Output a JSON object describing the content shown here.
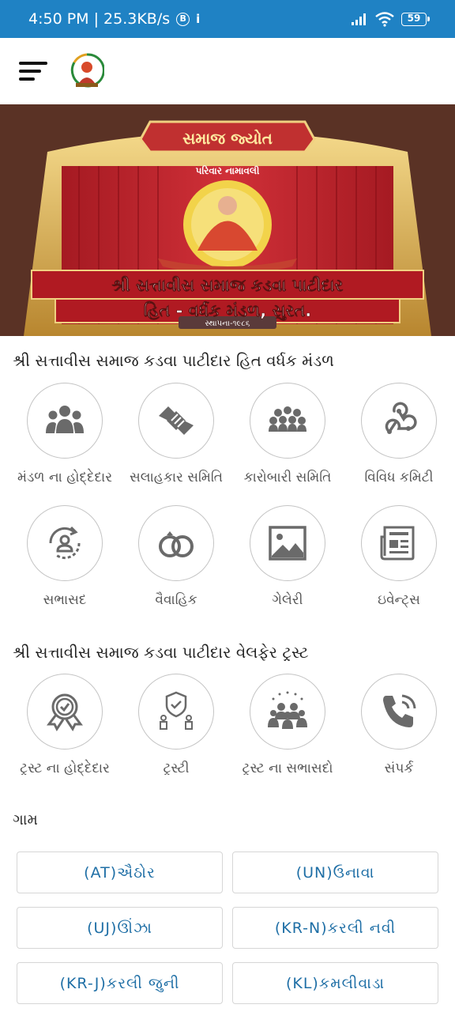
{
  "status_bar": {
    "time_speed": "4:50 PM | 25.3KB/s",
    "b_badge": "B",
    "info_icon": "i",
    "battery": "59"
  },
  "banner": {
    "top_title": "સમાજ જ્યોત",
    "subtitle": "પરિવાર નામાવલી",
    "line1": "શ્રી સત્તાવીસ સમાજ કડવા પાટીદાર",
    "line2": "હિત - વર્ધક મંડળ, સુરત.",
    "founded": "સ્થાપના-૧૯૮૬"
  },
  "mandal": {
    "title": "શ્રી સત્તાવીસ સમાજ કડવા પાટીદાર હિત વર્ધક મંડળ",
    "items": [
      {
        "label": "મંડળ ના હોદ્દેદાર",
        "icon": "users-group-icon"
      },
      {
        "label": "સલાહકાર સમિતિ",
        "icon": "handshake-icon"
      },
      {
        "label": "કારોબારી સમિતિ",
        "icon": "crowd-icon"
      },
      {
        "label": "વિવિધ કમિટી",
        "icon": "webhook-icon"
      },
      {
        "label": "સભાસદ",
        "icon": "user-cycle-icon"
      },
      {
        "label": "વૈવાહિક",
        "icon": "rings-icon"
      },
      {
        "label": "ગેલેરી",
        "icon": "image-gallery-icon"
      },
      {
        "label": "ઇવેન્ટ્સ",
        "icon": "newspaper-icon"
      }
    ]
  },
  "trust": {
    "title": "શ્રી સત્તાવીસ સમાજ કડવા પાટીદાર વેલફેર ટ્રસ્ટ",
    "items": [
      {
        "label": "ટ્રસ્ટ ના હોદ્દેદાર",
        "icon": "award-badge-icon"
      },
      {
        "label": "ટ્રસ્ટી",
        "icon": "shield-people-icon"
      },
      {
        "label": "ટ્રસ્ટ ના સભાસદો",
        "icon": "audience-icon"
      },
      {
        "label": "સંપર્ક",
        "icon": "phone-call-icon"
      }
    ]
  },
  "villages": {
    "title": "ગામ",
    "items": [
      "(AT)ઐઠોર",
      "(UN)ઉનાવા",
      "(UJ)ઊંઝા",
      "(KR-N)કરલી નવી",
      "(KR-J)કરલી જુની",
      "(KL)કમલીવાડા"
    ]
  },
  "colors": {
    "status_bar": "#1f82c4",
    "accent_text": "#1f6fa6",
    "icon_gray": "#6a6a6a"
  }
}
